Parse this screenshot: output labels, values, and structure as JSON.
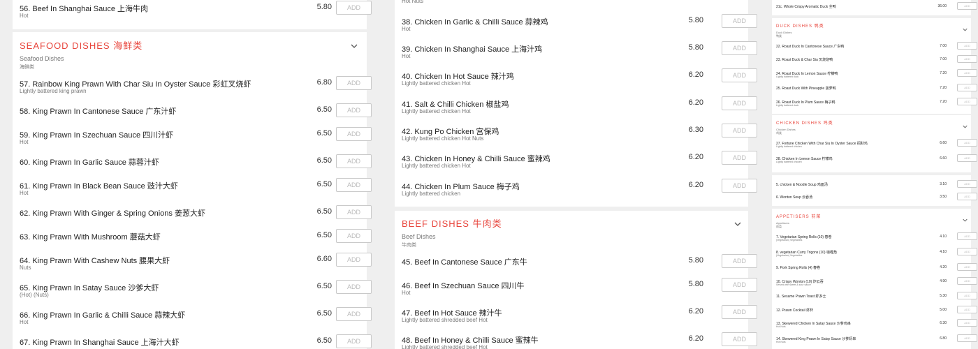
{
  "add_label": "ADD",
  "colors": {
    "accent": "#e8453c",
    "page_bg": "#efefef",
    "card_bg": "#ffffff"
  },
  "left": {
    "top_item": {
      "name": "56. Beef In Shanghai Sauce 上海牛肉",
      "sub": "Hot",
      "price": "5.80"
    },
    "seafood": {
      "title": "SEAFOOD DISHES 海鲜类",
      "category": "Seafood Dishes",
      "category_cn": "海鲜类",
      "items": [
        {
          "name": "57. Rainbow King Prawn With Char Siu In Oyster Sauce 彩虹叉烧虾",
          "sub": "Lightly battered king prawn",
          "price": "6.80"
        },
        {
          "name": "58. King Prawn In Cantonese Sauce 广东汁虾",
          "sub": "",
          "price": "6.50"
        },
        {
          "name": "59. King Prawn In Szechuan Sauce 四川汁虾",
          "sub": "Hot",
          "price": "6.50"
        },
        {
          "name": "60. King Prawn In Garlic Sauce 蒜蓉汁虾",
          "sub": "",
          "price": "6.50"
        },
        {
          "name": "61. King Prawn In Black Bean Sauce 豉汁大虾",
          "sub": "Hot",
          "price": "6.50"
        },
        {
          "name": "62. King Prawn With Ginger & Spring Onions 姜葱大虾",
          "sub": "",
          "price": "6.50"
        },
        {
          "name": "63. King Prawn With Mushroom 蘑菇大虾",
          "sub": "",
          "price": "6.50"
        },
        {
          "name": "64. King Prawn With Cashew Nuts 腰果大虾",
          "sub": "Nuts",
          "price": "6.60"
        },
        {
          "name": "65. King Prawn In Satay Sauce 沙爹大虾",
          "sub": "(Hot) (Nuts)",
          "price": "6.50"
        },
        {
          "name": "66. King Prawn In Garlic & Chilli Sauce 蒜辣大虾",
          "sub": "Hot",
          "price": "6.50"
        },
        {
          "name": "67. King Prawn In Shanghai Sauce 上海汁大虾",
          "sub": "",
          "price": "6.50"
        }
      ]
    }
  },
  "middle": {
    "top_sub": "Hot Nuts",
    "chicken_items": [
      {
        "name": "38. Chicken In Garlic & Chilli Sauce 蒜辣鸡",
        "sub": "Hot",
        "price": "5.80"
      },
      {
        "name": "39. Chicken In Shanghai Sauce 上海汁鸡",
        "sub": "Hot",
        "price": "5.80"
      },
      {
        "name": "40. Chicken In Hot Sauce 辣汁鸡",
        "sub": "Lightly battered chicken Hot",
        "price": "6.20"
      },
      {
        "name": "41. Salt & Chilli Chicken 椒盐鸡",
        "sub": "Lightly battered chicken Hot",
        "price": "6.20"
      },
      {
        "name": "42. Kung Po Chicken 宫保鸡",
        "sub": "Lightly battered chicken Hot Nuts",
        "price": "6.30"
      },
      {
        "name": "43. Chicken In Honey & Chilli Sauce 蜜辣鸡",
        "sub": "Lightly battered chicken Hot",
        "price": "6.20"
      },
      {
        "name": "44. Chicken In Plum Sauce 梅子鸡",
        "sub": "Lightly battered chicken",
        "price": "6.20"
      }
    ],
    "beef": {
      "title": "BEEF DISHES 牛肉类",
      "category": "Beef Dishes",
      "category_cn": "牛肉类",
      "items": [
        {
          "name": "45. Beef In Cantonese Sauce 广东牛",
          "sub": "",
          "price": "5.80"
        },
        {
          "name": "46. Beef In Szechuan Sauce 四川牛",
          "sub": "Hot",
          "price": "5.80"
        },
        {
          "name": "47. Beef In Hot Sauce 辣汁牛",
          "sub": "Lightly battered shredded beef Hot",
          "price": "6.20"
        },
        {
          "name": "48. Beef In Honey & Chilli Sauce 蜜辣牛",
          "sub": "Lightly battered shredded beef Hot",
          "price": "6.20"
        }
      ]
    }
  },
  "right": {
    "top_item": {
      "name": "21c. Whole Crispy Aromatic Duck 全鸭",
      "price": "36.00"
    },
    "duck": {
      "title": "DUCK DISHES 鸭类",
      "category": "Duck Dishes",
      "category_cn": "鸭类",
      "items": [
        {
          "name": "22. Roast Duck In Cantonese Sauce 广东鸭",
          "sub": "",
          "price": "7.00"
        },
        {
          "name": "23. Roast Duck & Char Siu 叉烧烧鸭",
          "sub": "",
          "price": "7.00"
        },
        {
          "name": "24. Roast Duck In Lemon Sauce 柠檬鸭",
          "sub": "Lightly battered duck",
          "price": "7.20"
        },
        {
          "name": "25. Roast Duck With Pineapple 菠萝鸭",
          "sub": "",
          "price": "7.20"
        },
        {
          "name": "26. Roast Duck In Plum Sauce 梅子鸭",
          "sub": "Lightly battered duck",
          "price": "7.20"
        }
      ]
    },
    "chicken": {
      "title": "CHICKEN DISHES 鸡类",
      "category": "Chicken Dishes",
      "category_cn": "鸡类",
      "items": [
        {
          "name": "27. Fortune Chicken With Char Siu In Oyster Sauce 招财鸡",
          "sub": "Lightly battered chicken",
          "price": "6.60"
        },
        {
          "name": "28. Chicken In Lemon Sauce 柠檬鸡",
          "sub": "Lightly battered chicken",
          "price": "6.60"
        }
      ]
    },
    "soup_items": [
      {
        "name": "5. chicken & Noodle Soup 鸡面汤",
        "price": "3.10"
      },
      {
        "name": "6. Wonton Soup 云吞汤",
        "price": "3.50"
      }
    ],
    "appetisers": {
      "title": "APPETISERS 前菜",
      "category": "Appetisers",
      "category_cn": "前菜",
      "items": [
        {
          "name": "7. Vegetarian Spring Rolls (10) 春卷",
          "sub": "(Vegetarian) Vegetables",
          "price": "4.10"
        },
        {
          "name": "8. vegetarian Curry Trigons (10) 咖喱角",
          "sub": "(Vegetarian) Vegetables",
          "price": "4.10"
        },
        {
          "name": "9. Pork Spring Rolls (4) 春卷",
          "sub": "",
          "price": "4.20"
        },
        {
          "name": "10. Crispy Wonton (10) 炸云吞",
          "sub": "Served with sweet & sour sauce",
          "price": "4.90"
        },
        {
          "name": "11. Sesame Prawn Toast 虾多士",
          "sub": "",
          "price": "5.30"
        },
        {
          "name": "12. Prawn Cocktail 虾杯",
          "sub": "",
          "price": "5.00"
        },
        {
          "name": "13. Skewered Chicken In Satay Sauce 沙爹鸡串",
          "sub": "Hot Nuts",
          "price": "6.30"
        },
        {
          "name": "14. Skewered King Prawn In Satay Sauce 沙爹虾串",
          "sub": "Hot Nuts",
          "price": "6.80"
        }
      ]
    }
  }
}
